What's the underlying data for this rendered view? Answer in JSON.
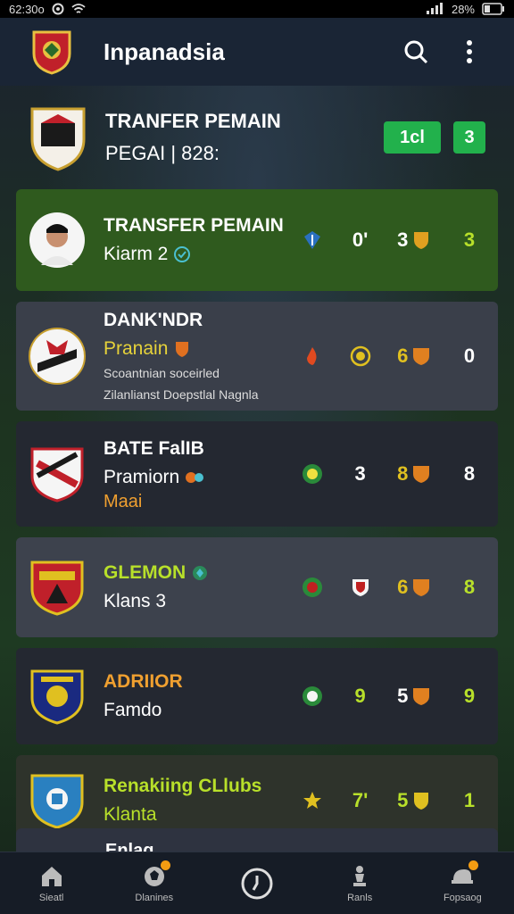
{
  "status_bar": {
    "time": "62:30o",
    "battery": "28%"
  },
  "app_bar": {
    "title": "Inpanadsia"
  },
  "header": {
    "title": "TRANFER PEMAIN",
    "subtitle": "PEGAI | 828:",
    "pill_1": "1cl",
    "pill_2": "3"
  },
  "rows": [
    {
      "name": "TRANSFER PEMAIN",
      "name_color": "#b8e02a",
      "sub": "Kiarm 2",
      "desc_1": "",
      "desc_2": "",
      "bg": "#2f5a1e",
      "stat_1": "0'",
      "stat_2": "3",
      "stat_3": "3",
      "stat_3_color": "#b8e02a"
    },
    {
      "name": "DANK'NDR",
      "name_color": "#ffffff",
      "sub": "Pranain",
      "sub_color": "#e6d23a",
      "desc_1": "Scoantnian soceirled",
      "desc_2": "Zilanlianst Doepstlal Nagnla",
      "bg": "#3a3f4a",
      "stat_1": "",
      "stat_2": "6",
      "stat_3": "0",
      "stat_3_color": "#ffffff"
    },
    {
      "name": "BATE FalIB",
      "name_color": "#ffffff",
      "sub": "Pramiorn",
      "sub_color": "#ffffff",
      "desc_1": "Maai",
      "desc_2": "",
      "bg": "#242831",
      "stat_1": "3",
      "stat_2": "8",
      "stat_3": "8",
      "stat_3_color": "#ffffff"
    },
    {
      "name": "GLEMON",
      "name_color": "#b8e02a",
      "sub": "Klans  3",
      "sub_color": "#ffffff",
      "desc_1": "",
      "desc_2": "",
      "bg": "#3d424d",
      "stat_1": "",
      "stat_2": "6",
      "stat_3": "8",
      "stat_3_color": "#b8e02a"
    },
    {
      "name": "ADRIIOR",
      "name_color": "#f0a030",
      "sub": "Famdo",
      "sub_color": "#ffffff",
      "desc_1": "",
      "desc_2": "",
      "bg": "#242831",
      "stat_1": "9",
      "stat_2": "5",
      "stat_3": "9",
      "stat_3_color": "#b8e02a"
    },
    {
      "name": "Renakiing CLlubs",
      "name_color": "#b8e02a",
      "sub": "Klanta",
      "sub_color": "#b8e02a",
      "desc_1": "",
      "desc_2": "",
      "bg": "#2e332b",
      "stat_1": "7'",
      "stat_2": "5",
      "stat_3": "1",
      "stat_3_color": "#b8e02a"
    }
  ],
  "partial_row": {
    "name": "Enlag"
  },
  "bottom_nav": [
    {
      "label": "Sieatl",
      "icon": "home-icon"
    },
    {
      "label": "Dlanines",
      "icon": "ball-icon"
    },
    {
      "label": "",
      "icon": "clock-icon"
    },
    {
      "label": "Ranls",
      "icon": "chess-icon"
    },
    {
      "label": "Fopsaog",
      "icon": "cap-icon"
    }
  ],
  "colors": {
    "accent_green": "#22b14c",
    "lime": "#b8e02a",
    "appbar": "#1a2535"
  }
}
